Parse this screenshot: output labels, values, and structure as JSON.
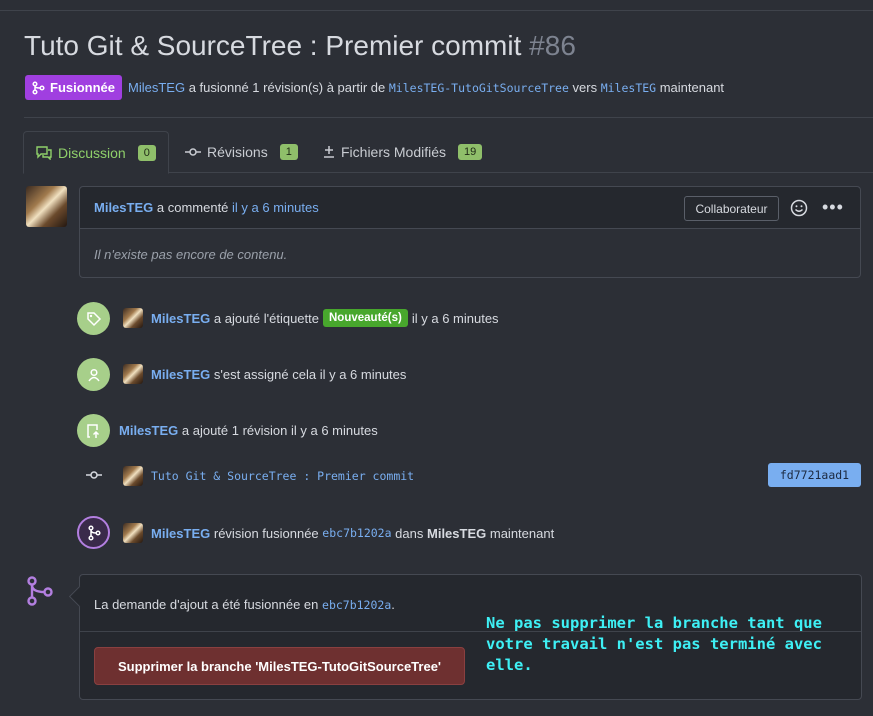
{
  "pr": {
    "title": "Tuto Git & SourceTree : Premier commit",
    "number": "#86",
    "status": "Fusionnée",
    "author": "MilesTEG",
    "merge_text": "a fusionné 1 révision(s) à partir de",
    "source_branch": "MilesTEG-TutoGitSourceTree",
    "to_word": "vers",
    "target_branch": "MilesTEG",
    "when": "maintenant"
  },
  "tabs": [
    {
      "label": "Discussion",
      "count": "0"
    },
    {
      "label": "Révisions",
      "count": "1"
    },
    {
      "label": "Fichiers Modifiés",
      "count": "19"
    }
  ],
  "comment": {
    "author": "MilesTEG",
    "action": "a commenté",
    "time": "il y a 6 minutes",
    "role": "Collaborateur",
    "body": "Il n'existe pas encore de contenu."
  },
  "timeline": {
    "label_event": {
      "user": "MilesTEG",
      "action": "a ajouté l'étiquette",
      "label": "Nouveauté(s)",
      "time": "il y a 6 minutes"
    },
    "assign_event": {
      "user": "MilesTEG",
      "text": "s'est assigné cela il y a 6 minutes"
    },
    "revision_event": {
      "user": "MilesTEG",
      "text": "a ajouté 1 révision il y a 6 minutes"
    },
    "commit": {
      "message": "Tuto Git & SourceTree : Premier commit",
      "hash": "fd7721aad1"
    },
    "merge_event": {
      "user": "MilesTEG",
      "action": "révision fusionnée",
      "commit": "ebc7b1202a",
      "in_word": "dans",
      "branch": "MilesTEG",
      "when": "maintenant"
    }
  },
  "merge_box": {
    "text": "La demande d'ajout a été fusionnée en",
    "commit": "ebc7b1202a",
    "period": ".",
    "delete_button": "Supprimer la branche 'MilesTEG-TutoGitSourceTree'"
  },
  "annotation": {
    "text": "Ne pas supprimer la branche tant que votre travail n'est pas terminé avec elle.",
    "color": "#3ef0f5"
  },
  "colors": {
    "background": "#2c2f36",
    "merged_badge": "#a03fe0",
    "link": "#79aef0",
    "tab_active": "#8fd06a",
    "label_new": "#48a72d",
    "delete_button": "#6e3030"
  }
}
